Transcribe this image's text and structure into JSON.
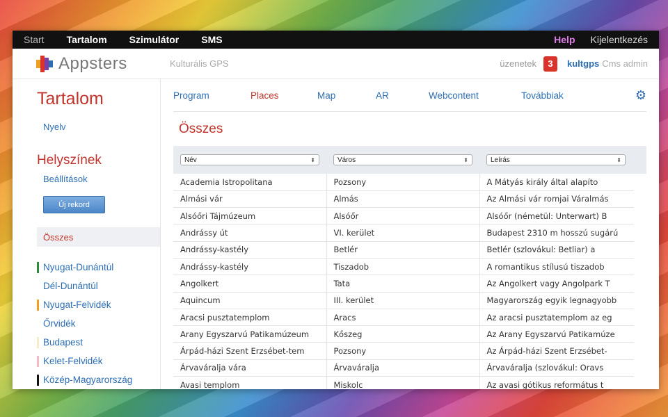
{
  "topnav": {
    "items": [
      "Start",
      "Tartalom",
      "Szimulátor",
      "SMS"
    ],
    "help": "Help",
    "logout": "Kijelentkezés"
  },
  "header": {
    "logo_text": "Appsters",
    "app_name": "Kulturális GPS",
    "messages_label": "üzenetek",
    "messages_count": "3",
    "user_name": "kultgps",
    "user_role": "Cms admin"
  },
  "sidebar": {
    "title": "Tartalom",
    "language_link": "Nyelv",
    "section_title": "Helyszínek",
    "settings_link": "Beállítások",
    "new_button": "Új rekord",
    "all_item": "Összes",
    "regions": [
      {
        "label": "Nyugat-Dunántúl",
        "color": "#2e8b3e"
      },
      {
        "label": "Dél-Dunántúl",
        "color": ""
      },
      {
        "label": "Nyugat-Felvidék",
        "color": "#f0a01e"
      },
      {
        "label": "Őrvidék",
        "color": ""
      },
      {
        "label": "Budapest",
        "color": "#f5ecc8"
      },
      {
        "label": "Kelet-Felvidék",
        "color": "#f5b8c4"
      },
      {
        "label": "Közép-Magyarország",
        "color": "#111111"
      }
    ]
  },
  "tabs": [
    "Program",
    "Places",
    "Map",
    "AR",
    "Webcontent",
    "Továbbiak"
  ],
  "active_tab": "Places",
  "page_title": "Összes",
  "filters": [
    "Név",
    "Város",
    "Leírás"
  ],
  "rows": [
    [
      "Academia Istropolitana",
      "Pozsony",
      "A Mátyás király által alapíto"
    ],
    [
      "Almási vár",
      "Almás",
      "Az Almási vár romjai Váralmás"
    ],
    [
      "Alsóőri Tájmúzeum",
      "Alsóőr",
      "Alsóőr (németül: Unterwart) B"
    ],
    [
      "Andrássy út",
      "VI. kerület",
      "Budapest 2310 m hosszú sugárú"
    ],
    [
      "Andrássy-kastély",
      "Betlér",
      "Betlér (szlovákul: Betliar) a"
    ],
    [
      "Andrássy-kastély",
      "Tiszadob",
      "A romantikus stílusú tiszadob"
    ],
    [
      "Angolkert",
      "Tata",
      "Az Angolkert vagy Angolpark T"
    ],
    [
      "Aquincum",
      "III. kerület",
      "Magyarország egyik legnagyobb"
    ],
    [
      "Aracsi pusztatemplom",
      "Aracs",
      "Az aracsi pusztatemplom az eg"
    ],
    [
      "Arany Egyszarvú Patikamúzeum",
      "Kőszeg",
      "Az Arany Egyszarvú Patikamúze"
    ],
    [
      "Árpád-házi Szent Erzsébet-tem",
      "Pozsony",
      "Az Árpád-házi Szent Erzsébet-"
    ],
    [
      "Árvaváralja vára",
      "Árvaváralja",
      "Árvaváralja (szlovákul: Oravs"
    ],
    [
      "Avasi templom",
      "Miskolc",
      "Az avasi gótikus református t"
    ]
  ]
}
